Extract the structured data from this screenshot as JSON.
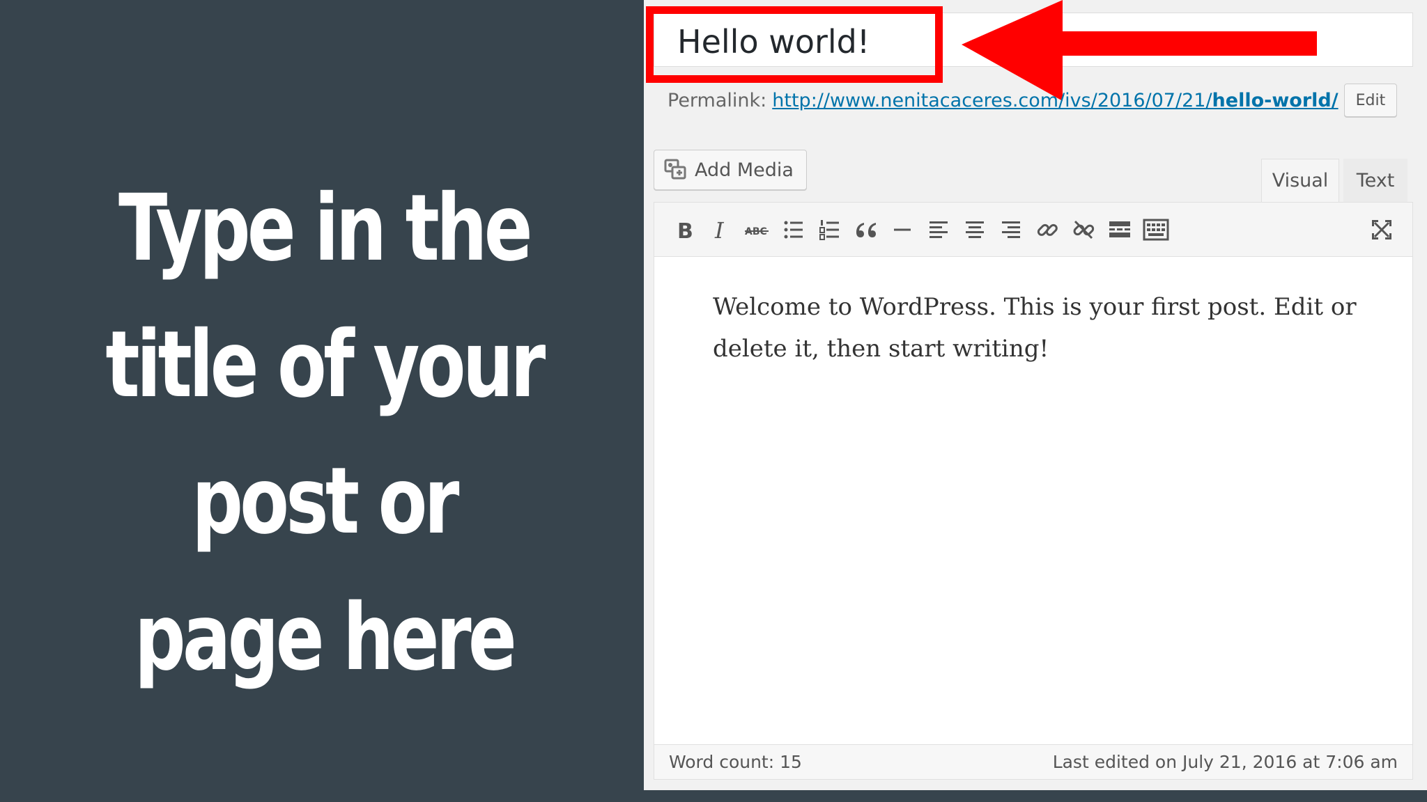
{
  "slide": {
    "headline": "Type in the title of your post or page here"
  },
  "editor": {
    "title_value": "Hello world!",
    "permalink_label": "Permalink:",
    "permalink_url_base": "http://www.nenitacaceres.com/ivs/2016/07/21/",
    "permalink_url_slug": "hello-world/",
    "edit_label": "Edit",
    "add_media_label": "Add Media",
    "tabs": [
      {
        "label": "Visual",
        "active": true
      },
      {
        "label": "Text",
        "active": false
      }
    ],
    "toolbar_icons": [
      "bold-icon",
      "italic-icon",
      "strikethrough-icon",
      "bulleted-list-icon",
      "numbered-list-icon",
      "blockquote-icon",
      "horizontal-line-icon",
      "align-left-icon",
      "align-center-icon",
      "align-right-icon",
      "link-icon",
      "unlink-icon",
      "read-more-icon",
      "toolbar-toggle-icon",
      "fullscreen-icon"
    ],
    "content": "Welcome to WordPress. This is your first post. Edit or delete it, then start writing!",
    "word_count": "Word count: 15",
    "last_edited": "Last edited on July 21, 2016 at 7:06 am"
  },
  "colors": {
    "slide_bg": "#37444d",
    "highlight": "#ff0000",
    "link": "#0073aa"
  }
}
